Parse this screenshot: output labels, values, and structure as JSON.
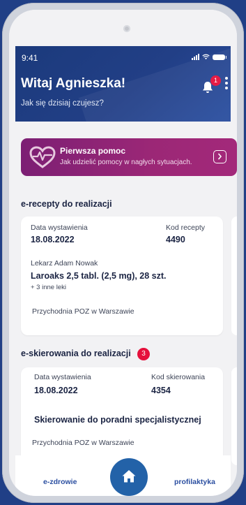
{
  "status_bar": {
    "time": "9:41"
  },
  "header": {
    "greeting": "Witaj Agnieszka!",
    "subtitle": "Jak się dzisiaj czujesz?",
    "notification_count": "1"
  },
  "first_aid": {
    "title": "Pierwsza pomoc",
    "description": "Jak udzielić pomocy w nagłych sytuacjach."
  },
  "prescriptions": {
    "section_title": "e-recepty do realizacji",
    "card": {
      "date_label": "Data wystawienia",
      "date_value": "18.08.2022",
      "code_label": "Kod recepty",
      "code_value": "4490",
      "doctor": "Lekarz Adam Nowak",
      "medicine": "Laroaks 2,5 tabl. (2,5 mg), 28 szt.",
      "more": "+ 3 inne leki",
      "clinic": "Przychodnia POZ w Warszawie"
    }
  },
  "referrals": {
    "section_title": "e-skierowania do realizacji",
    "count": "3",
    "card": {
      "date_label": "Data wystawienia",
      "date_value": "18.08.2022",
      "code_label": "Kod skierowania",
      "code_value": "4354",
      "title": "Skierowanie do poradni specjalistycznej",
      "clinic": "Przychodnia POZ w Warszawie"
    }
  },
  "bottom_nav": {
    "left_label": "e-zdrowie",
    "right_label": "profilaktyka"
  },
  "colors": {
    "header_blue": "#223f86",
    "accent_magenta": "#9b2776",
    "badge_red": "#e5103c",
    "home_blue": "#2362a8"
  }
}
